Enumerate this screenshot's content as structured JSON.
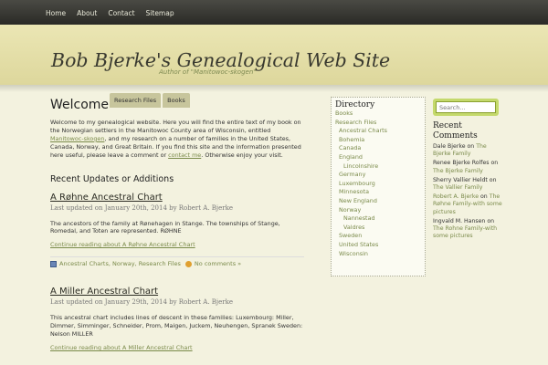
{
  "topnav": [
    "Home",
    "About",
    "Contact",
    "Sitemap"
  ],
  "header": {
    "title": "Bob Bjerke's Genealogical Web Site",
    "tagline": "Author of \"Manitowoc-skogen\""
  },
  "subnav": [
    "Research Files",
    "Books"
  ],
  "content": {
    "heading": "Welcome",
    "welcome": {
      "t1": "Welcome to my genealogical website. Here you will find the entire text of my book on the Norwegian settlers in the Manitowoc County area of Wisconsin, entitled ",
      "link1": "Manitowoc-skogen",
      "t2": ", and my research on a number of families in the United States, Canada, Norway, and Great Britain. If you find this site and the information presented here useful, please leave a comment or ",
      "link2": "contact me",
      "t3": ". Otherwise enjoy your visit."
    },
    "recent_heading": "Recent Updates or Additions",
    "posts": [
      {
        "title": "A Røhne Ancestral Chart",
        "meta": "Last updated on January 20th, 2014 by Robert A. Bjerke",
        "body": "The ancestors of the family at Rønehagen in Stange. The townships of Stange, Romedal, and Toten are represented. RØHNE",
        "continue": "Continue reading about A Røhne Ancestral Chart",
        "categories": "Ancestral Charts, Norway, Research Files",
        "comments": "No comments »"
      },
      {
        "title": "A Miller Ancestral Chart",
        "meta": "Last updated on January 29th, 2014 by Robert A. Bjerke",
        "body": "This ancestral chart includes lines of descent in these families: Luxembourg: Miller, Dimmer, Simminger, Schneider, Prom, Maigen, Juckem, Neuhengen, Spranek Sweden: Nelson MILLER",
        "continue": "Continue reading about A Miller Ancestral Chart"
      }
    ]
  },
  "directory": {
    "title": "Directory",
    "items": [
      {
        "label": "Books",
        "level": 0
      },
      {
        "label": "Research Files",
        "level": 0
      },
      {
        "label": "Ancestral Charts",
        "level": 1
      },
      {
        "label": "Bohemia",
        "level": 1
      },
      {
        "label": "Canada",
        "level": 1
      },
      {
        "label": "England",
        "level": 1
      },
      {
        "label": "Lincolnshire",
        "level": 2
      },
      {
        "label": "Germany",
        "level": 1
      },
      {
        "label": "Luxembourg",
        "level": 1
      },
      {
        "label": "Minnesota",
        "level": 1
      },
      {
        "label": "New England",
        "level": 1
      },
      {
        "label": "Norway",
        "level": 1
      },
      {
        "label": "Nannestad",
        "level": 2
      },
      {
        "label": "Valdres",
        "level": 2
      },
      {
        "label": "Sweden",
        "level": 1
      },
      {
        "label": "United States",
        "level": 1
      },
      {
        "label": "Wisconsin",
        "level": 1
      }
    ]
  },
  "search": {
    "placeholder": "Search..."
  },
  "recent_comments": {
    "title": "Recent Comments",
    "items": [
      {
        "author": "Dale Bjerke",
        "on": "on",
        "post": "The Bjerke Family"
      },
      {
        "author": "Renee Bjerke Rolfes",
        "on": "on",
        "post": "The Bjerke Family"
      },
      {
        "author": "Sherry Vallier Heldt",
        "on": "on",
        "post": "The Vallier Family"
      },
      {
        "author": "Robert A. Bjerke",
        "on": "on",
        "post": "The Røhne Family-with some pictures"
      },
      {
        "author": "Ingvald M. Hansen",
        "on": "on",
        "post": "The Rohne Family-with some pictures"
      }
    ]
  },
  "colors": {
    "accent": "#7a8a4a",
    "header_bg": "#e4dfa8",
    "search_border": "#c4d96c"
  }
}
